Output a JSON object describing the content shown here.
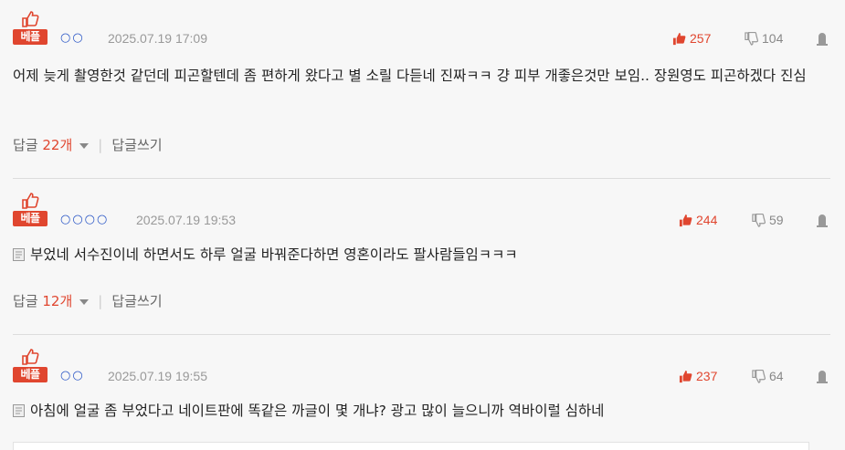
{
  "comments": [
    {
      "badge": "베플",
      "user": "○○",
      "date": "2025.07.19 17:09",
      "likes": "257",
      "dislikes": "104",
      "text": "어제 늦게 촬영한것 같던데 피곤할텐데 좀 편하게 왔다고 별 소릴 다듣네 진짜ㅋㅋ 걍 피부 개좋은것만 보임.. 장원영도 피곤하겠다 진심",
      "reply_label": "답글",
      "reply_count": "22개",
      "write_reply": "답글쓰기"
    },
    {
      "badge": "베플",
      "user": "○○○○",
      "date": "2025.07.19 19:53",
      "likes": "244",
      "dislikes": "59",
      "text": "부었네 서수진이네 하면서도 하루 얼굴 바꿔준다하면 영혼이라도 팔사람들임ㅋㅋㅋ",
      "reply_label": "답글",
      "reply_count": "12개",
      "write_reply": "답글쓰기"
    },
    {
      "badge": "베플",
      "user": "○○",
      "date": "2025.07.19 19:55",
      "likes": "237",
      "dislikes": "64",
      "text": "아침에 얼굴 좀 부었다고 네이트판에 똑같은 까글이 몇 개냐? 광고 많이 늘으니까 역바이럴 심하네"
    }
  ],
  "colors": {
    "accent": "#e0462f",
    "user": "#2a56c6",
    "muted": "#999999"
  },
  "icons": {
    "best": "thumbs-up-icon",
    "like": "thumbs-up-icon",
    "dislike": "thumbs-down-icon",
    "report": "report-icon",
    "memo": "memo-icon"
  }
}
